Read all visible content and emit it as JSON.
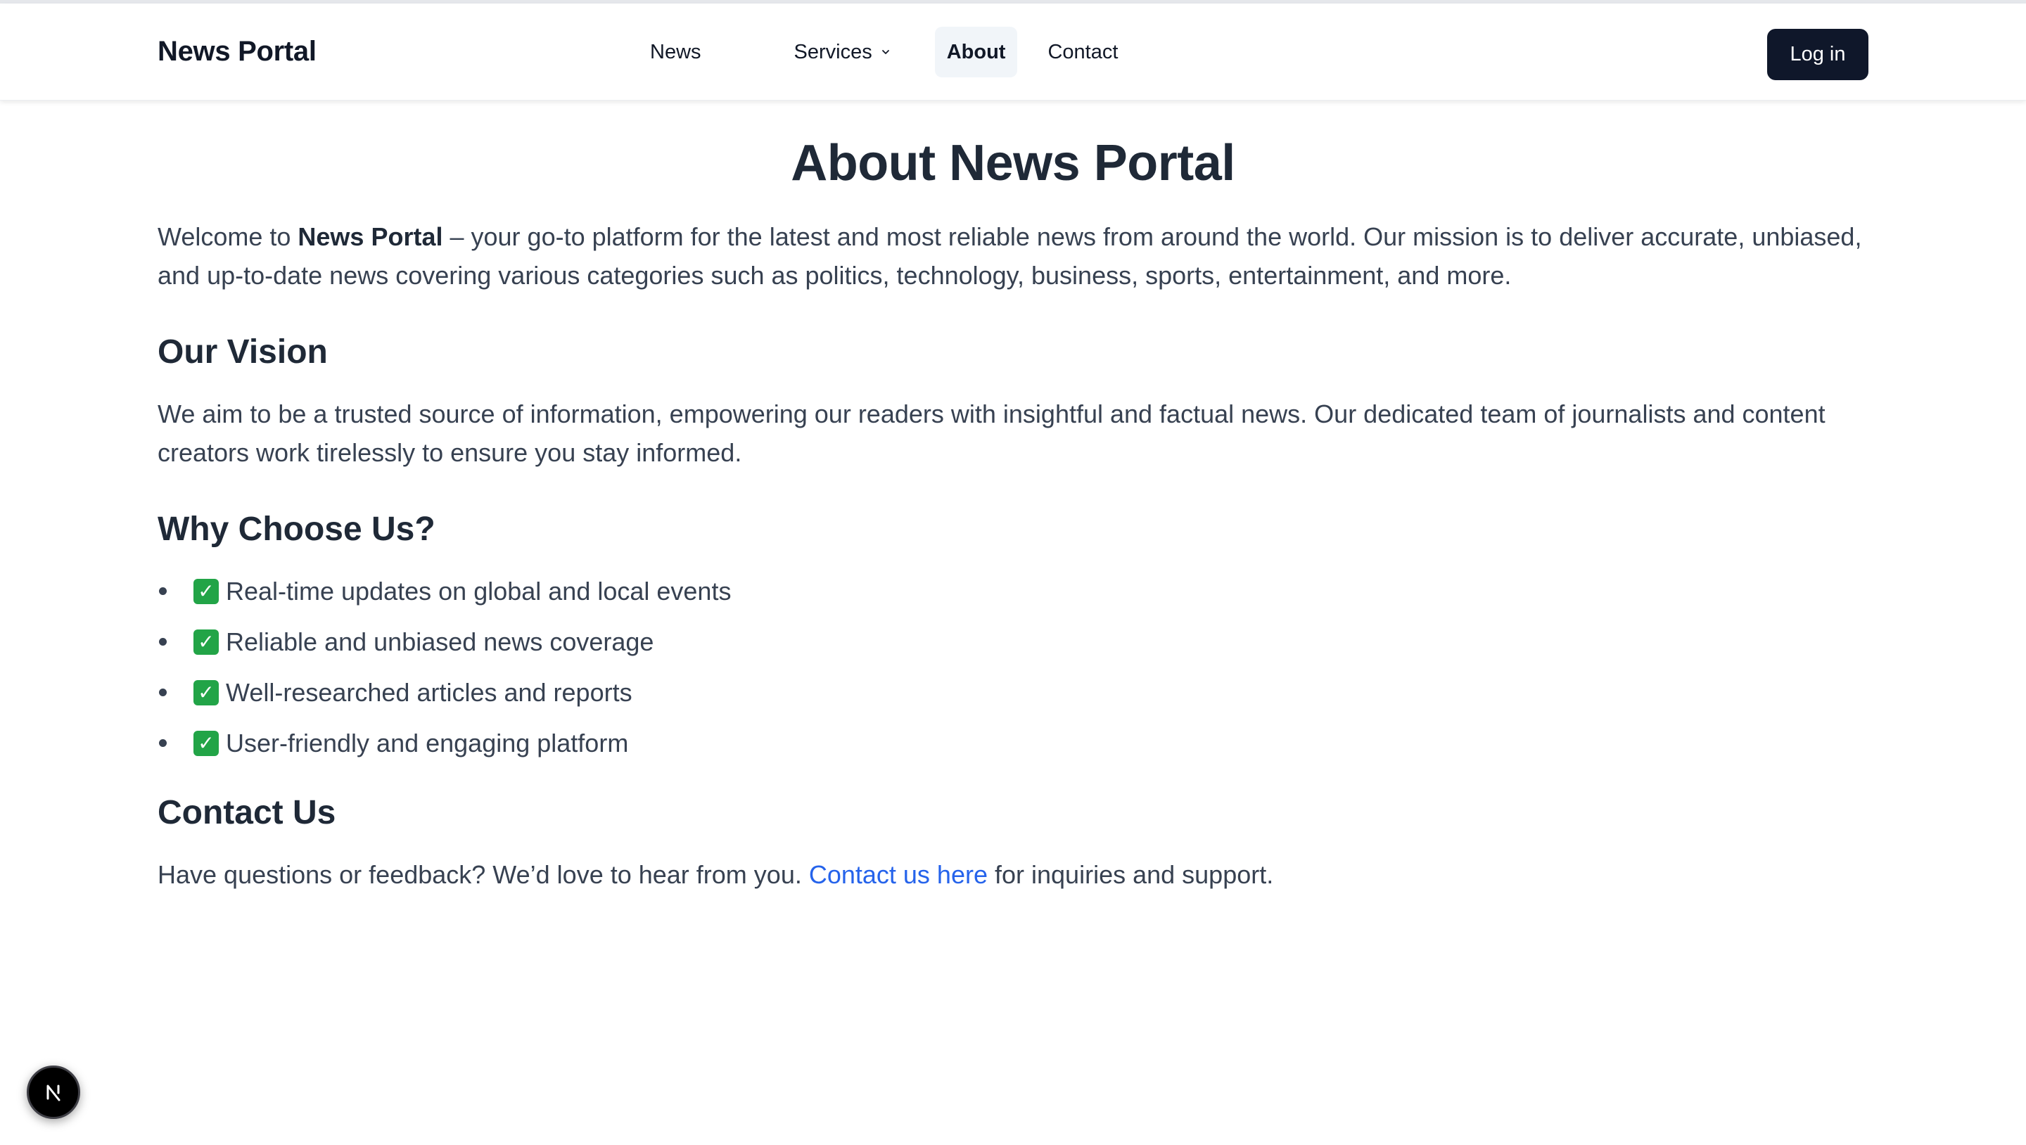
{
  "header": {
    "brand": "News Portal",
    "nav": {
      "news": "News",
      "services": "Services",
      "about": "About",
      "contact": "Contact"
    },
    "login_label": "Log in"
  },
  "main": {
    "title": "About News Portal",
    "intro": {
      "prefix": "Welcome to ",
      "brand": "News Portal",
      "suffix": " – your go-to platform for the latest and most reliable news from around the world. Our mission is to deliver accurate, unbiased, and up-to-date news covering various categories such as politics, technology, business, sports, entertainment, and more."
    },
    "vision": {
      "heading": "Our Vision",
      "body": "We aim to be a trusted source of information, empowering our readers with insightful and factual news. Our dedicated team of journalists and content creators work tirelessly to ensure you stay informed."
    },
    "why": {
      "heading": "Why Choose Us?",
      "check_glyph": "✓",
      "items": [
        "Real-time updates on global and local events",
        "Reliable and unbiased news coverage",
        "Well-researched articles and reports",
        "User-friendly and engaging platform"
      ]
    },
    "contact": {
      "heading": "Contact Us",
      "prefix": "Have questions or feedback? We’d love to hear from you. ",
      "link_text": "Contact us here",
      "suffix": " for inquiries and support."
    }
  },
  "dev_badge": {
    "icon": "nextjs-logo-icon"
  },
  "colors": {
    "primary_button": "#0f172a",
    "link": "#2563eb",
    "check": "#22a447",
    "active_nav_bg": "#f1f5f9"
  }
}
